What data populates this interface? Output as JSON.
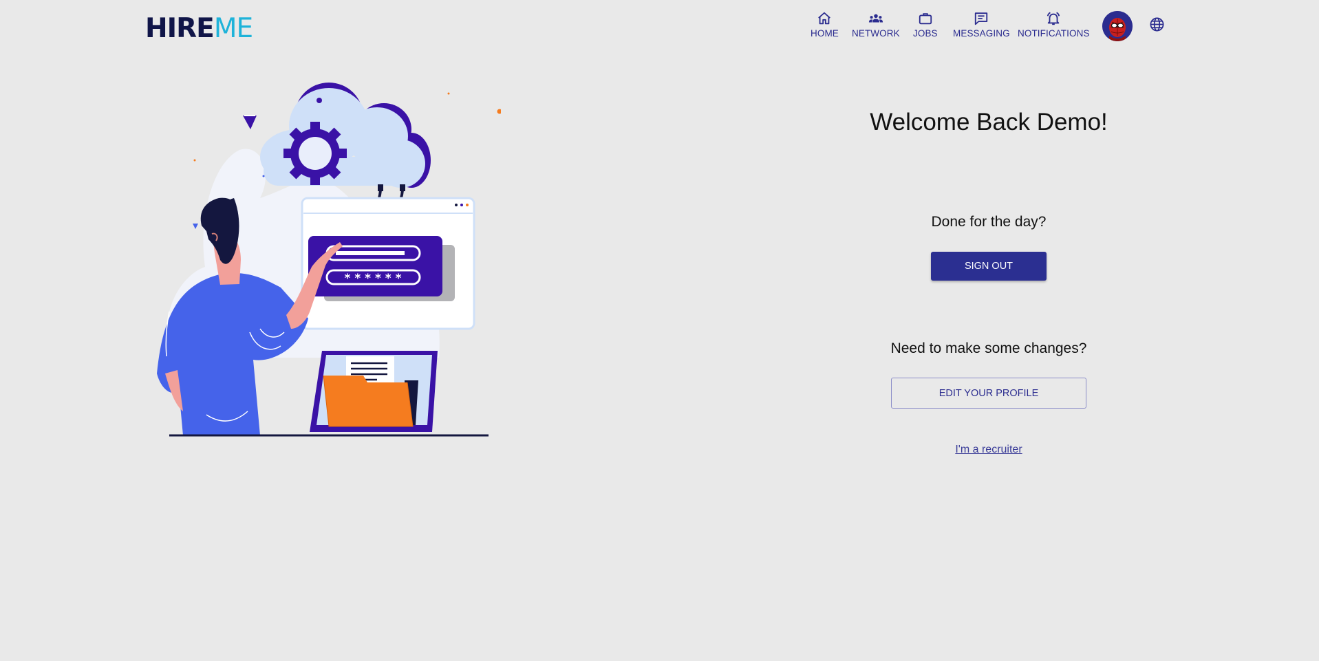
{
  "brand": {
    "logo_part1": "HIRE",
    "logo_part2": "ME"
  },
  "nav": {
    "items": [
      {
        "label": "HOME",
        "icon": "home-icon"
      },
      {
        "label": "NETWORK",
        "icon": "people-icon"
      },
      {
        "label": "JOBS",
        "icon": "briefcase-icon"
      },
      {
        "label": "MESSAGING",
        "icon": "message-icon"
      },
      {
        "label": "NOTIFICATIONS",
        "icon": "bell-icon"
      }
    ],
    "avatar_icon": "avatar-icon",
    "language_icon": "globe-icon"
  },
  "main": {
    "welcome": "Welcome Back Demo!",
    "signout_prompt": "Done for the day?",
    "signout_label": "SIGN OUT",
    "edit_prompt": "Need to make some changes?",
    "edit_label": "EDIT YOUR PROFILE",
    "recruiter_link": "I'm a recruiter"
  },
  "illustration": {
    "password_mask": "* * * * * *"
  },
  "colors": {
    "background": "#e9e9e9",
    "primary": "#2b2f91",
    "logo_dark": "#101548",
    "logo_light": "#1fb3d9",
    "accent_orange": "#f57c1f",
    "accent_purple": "#3a12a6"
  }
}
